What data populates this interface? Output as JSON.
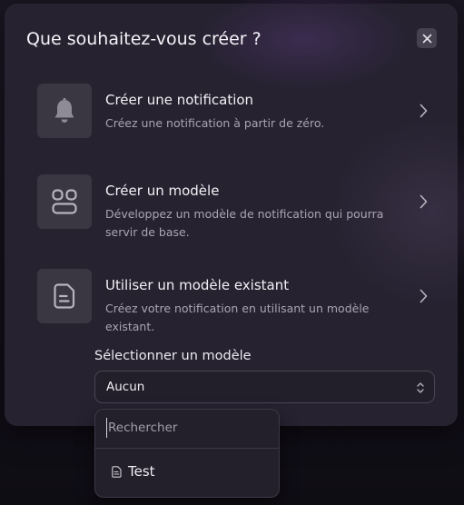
{
  "dialog": {
    "title": "Que souhaitez-vous créer ?",
    "close_icon": "close-icon"
  },
  "options": [
    {
      "icon": "bell-icon",
      "title": "Créer une notification",
      "description": "Créez une notification à partir de zéro."
    },
    {
      "icon": "template-blocks-icon",
      "title": "Créer un modèle",
      "description": "Développez un modèle de notification qui pourra servir de base."
    },
    {
      "icon": "document-icon",
      "title": "Utiliser un modèle existant",
      "description": "Créez votre notification en utilisant un modèle existant."
    }
  ],
  "template_select": {
    "label": "Sélectionner un modèle",
    "value": "Aucun",
    "arrows_icon": "chevron-up-down-icon"
  },
  "dropdown": {
    "search_placeholder": "Rechercher",
    "search_value": "",
    "items": [
      {
        "icon": "file-icon",
        "label": "Test"
      }
    ]
  },
  "colors": {
    "dialog_background": "#262230",
    "icon_tile": "#3a3642",
    "text_primary": "#f3f1f6",
    "text_secondary": "#a9a5b1",
    "border": "#4a4553"
  }
}
